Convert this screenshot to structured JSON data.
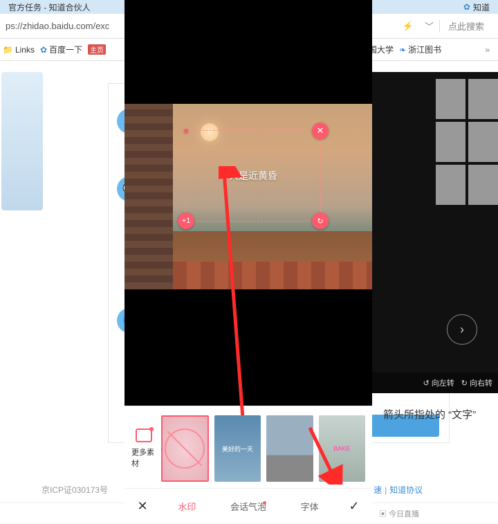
{
  "browser": {
    "tab1_title": "官方任务 - 知道合伙人",
    "tab2_partial": "知道",
    "url": "ps://zhidao.baidu.com/exc",
    "search_placeholder": "点此搜索"
  },
  "bookmarks": {
    "links": "Links",
    "baidu": "百度一下",
    "home_badge": "主页",
    "univ": "全国大学",
    "zj_lib": "浙江图书"
  },
  "gallery": {
    "rotate_left": "向左转",
    "rotate_right": "向右转",
    "nav_next": "›"
  },
  "page": {
    "caption_partial": "箭头所指处的 “文字”"
  },
  "footer": {
    "icp": "京ICP证030173号",
    "agreement": "知道协议",
    "sep": " | "
  },
  "bottombar": {
    "live": "今日直播"
  },
  "phone": {
    "crop_text": "只是近黄昏",
    "plus_one": "+1",
    "close_x": "✕",
    "rotate": "↻",
    "more_label": "更多素材",
    "thumb_sky_text": "美好的一天",
    "thumb_bike_text": "BAKE",
    "tabs": {
      "watermark": "水印",
      "bubble": "会话气泡",
      "font": "字体"
    },
    "cancel": "✕",
    "confirm": "✓"
  }
}
